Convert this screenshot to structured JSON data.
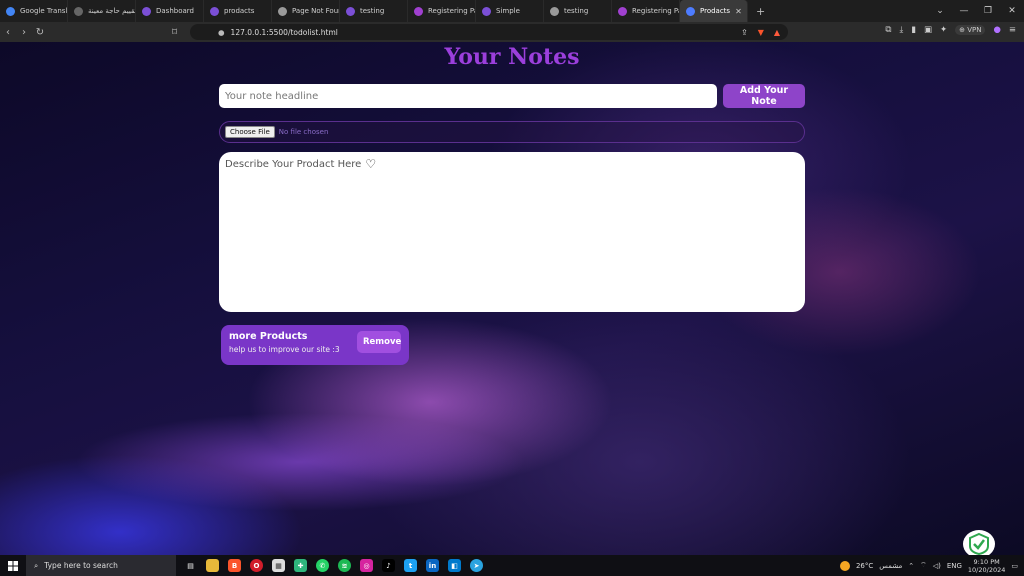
{
  "browser": {
    "tabs": [
      {
        "label": "Google Translate",
        "color": "#4285f4",
        "active": false
      },
      {
        "label": "تقييم حاجة معينة",
        "color": "#666666",
        "active": false
      },
      {
        "label": "Dashboard",
        "color": "#7b4fd6",
        "active": false
      },
      {
        "label": "prodacts",
        "color": "#7b4fd6",
        "active": false
      },
      {
        "label": "Page Not Found (",
        "color": "#9a9a9a",
        "active": false
      },
      {
        "label": "testing",
        "color": "#7b4fd6",
        "active": false
      },
      {
        "label": "Registering Page",
        "color": "#a040d0",
        "active": false
      },
      {
        "label": "Simple",
        "color": "#7b4fd6",
        "active": false
      },
      {
        "label": "testing",
        "color": "#9a9a9a",
        "active": false
      },
      {
        "label": "Registering Page",
        "color": "#a040d0",
        "active": false
      },
      {
        "label": "Prodacts",
        "color": "#4d7cff",
        "active": true
      }
    ],
    "url": "127.0.0.1:5500/todolist.html",
    "vpn_label": "VPN"
  },
  "page": {
    "title": "Your Notes",
    "headline_placeholder": "Your note headline",
    "add_button": "Add Your Note",
    "file_button": "Choose File",
    "file_status": "No file chosen",
    "description_placeholder": "Describe Your Prodact Here",
    "heart_icon": "♡",
    "note": {
      "name": "more Products",
      "description": "help us to improve our site :3",
      "remove_label": "Remove"
    },
    "accent_color": "#9b3fdc"
  },
  "taskbar": {
    "search_placeholder": "Type here to search",
    "weather_temp": "26°C",
    "weather_desc": "مشمس",
    "language": "ENG",
    "time": "9:10 PM",
    "date": "10/20/2024"
  }
}
